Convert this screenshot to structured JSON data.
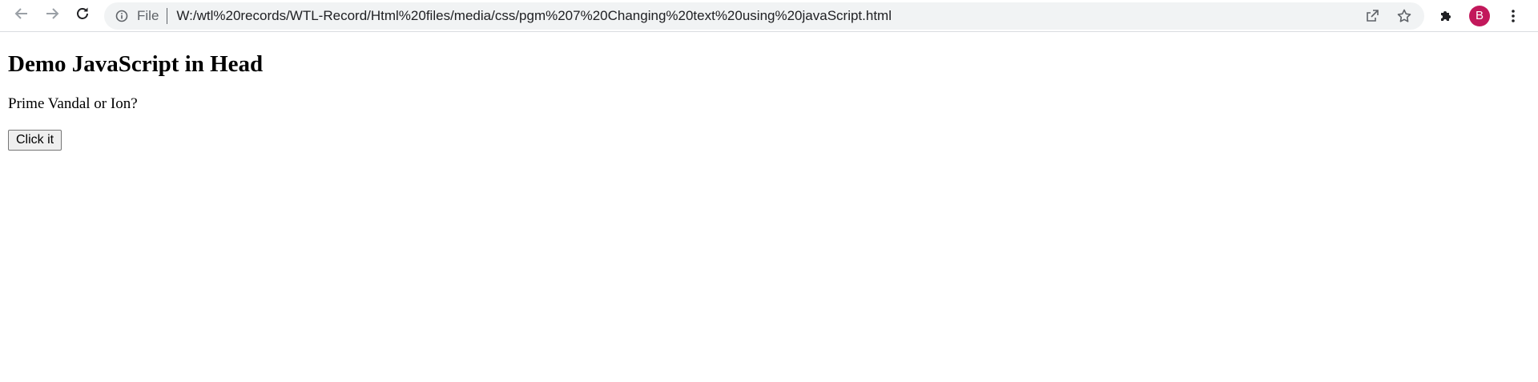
{
  "browser": {
    "address_bar": {
      "scheme_label": "File",
      "url": "W:/wtl%20records/WTL-Record/Html%20files/media/css/pgm%207%20Changing%20text%20using%20javaScript.html"
    },
    "profile": {
      "initial": "B",
      "color": "#c2185b"
    },
    "icons": {
      "back": "arrow-left-icon",
      "forward": "arrow-right-icon",
      "reload": "reload-icon",
      "site_info": "info-icon",
      "share": "share-icon",
      "bookmark": "star-icon",
      "extensions": "puzzle-icon",
      "menu": "kebab-menu-icon"
    }
  },
  "page": {
    "heading": "Demo JavaScript in Head",
    "paragraph": "Prime Vandal or Ion?",
    "button_label": "Click it"
  }
}
